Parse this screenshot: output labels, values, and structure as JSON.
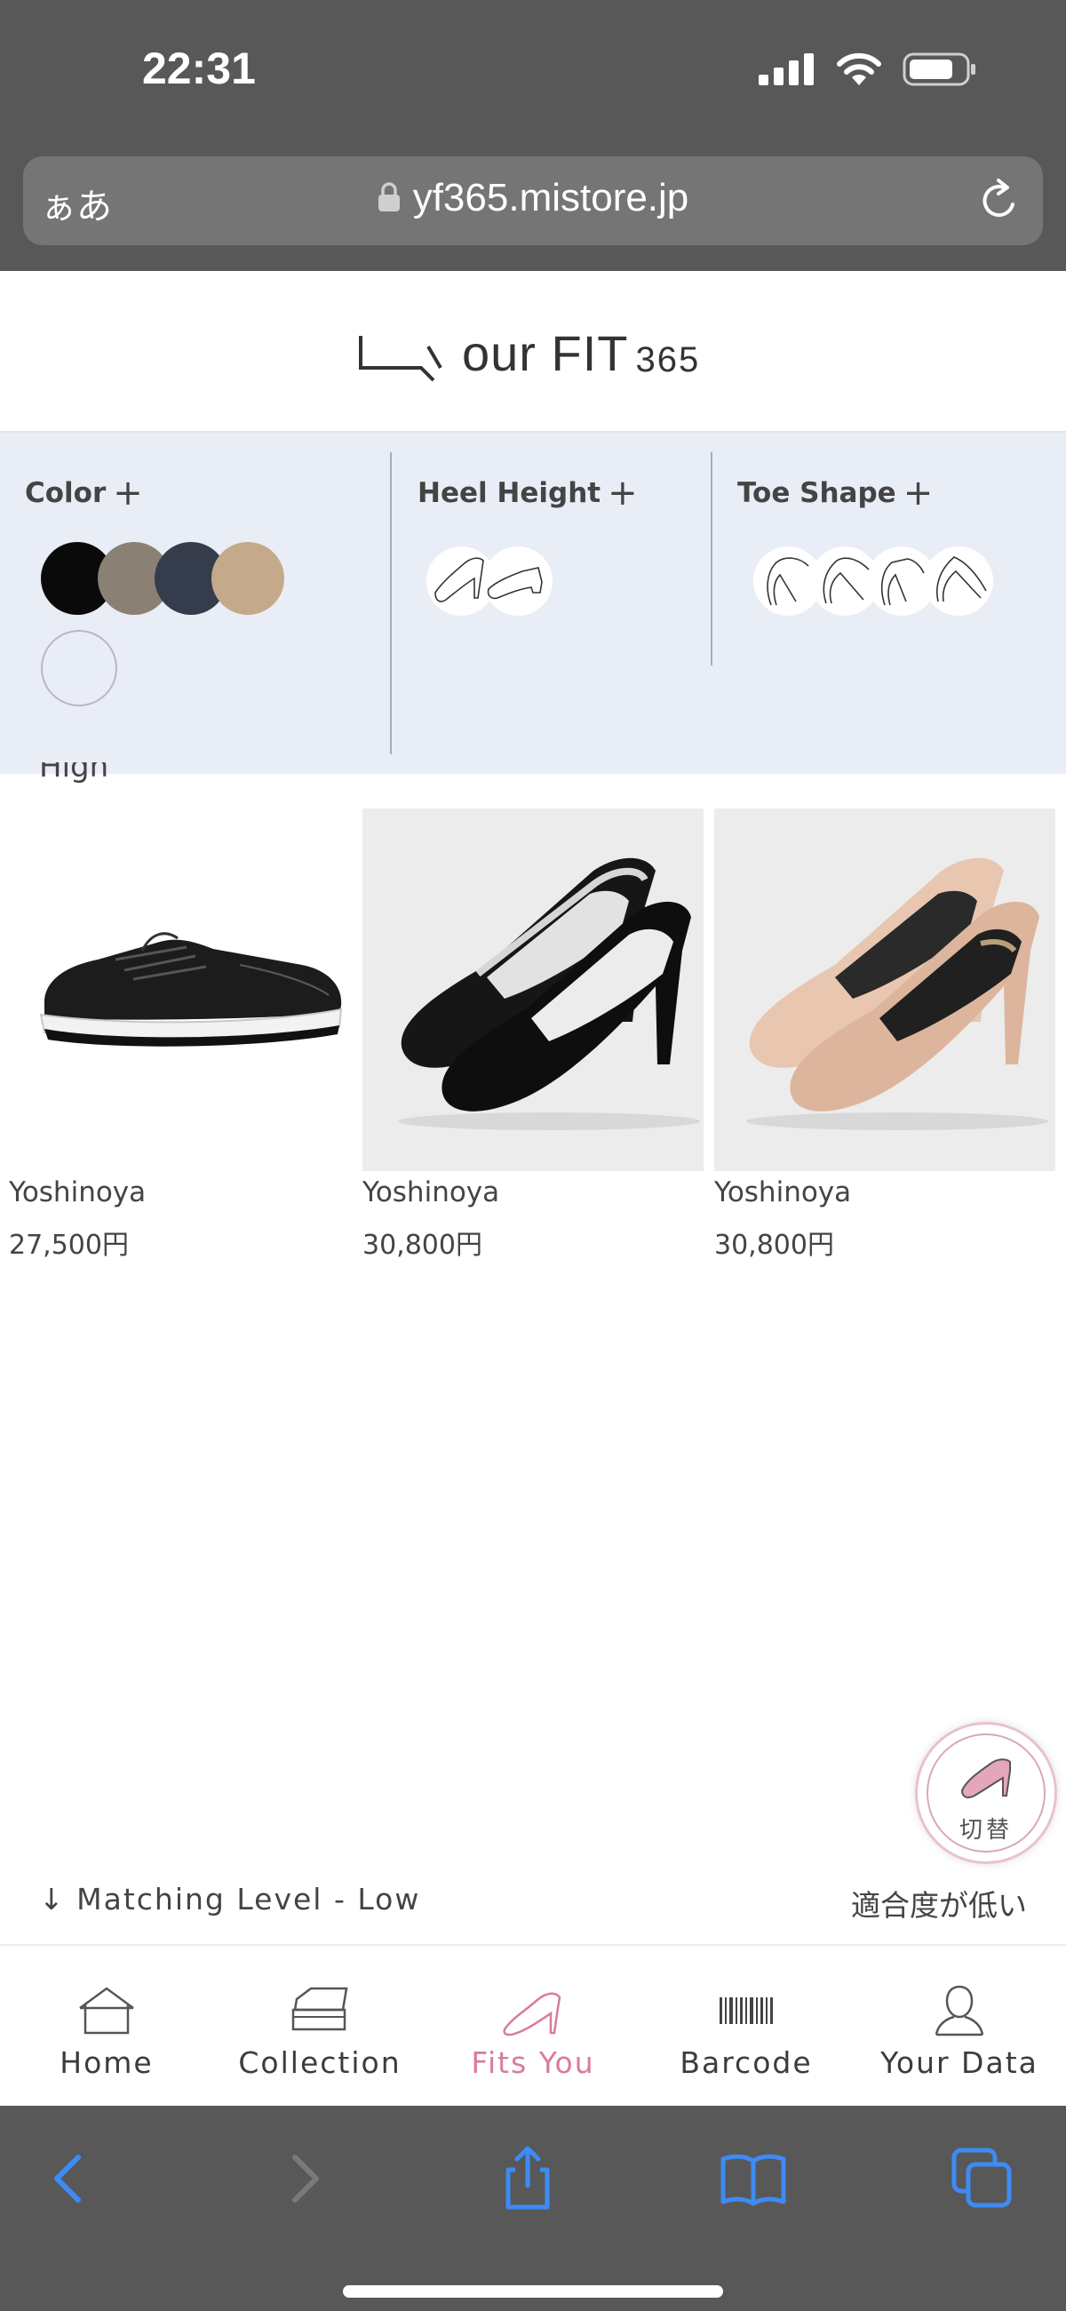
{
  "status": {
    "time": "22:31"
  },
  "browser": {
    "aa_label": "ぁあ",
    "url": "yf365.mistore.jp"
  },
  "brand": {
    "logo_text": "\\_/our FIT",
    "logo_num": "365"
  },
  "filters": {
    "color": {
      "title": "Color",
      "plus": "+",
      "swatches": [
        "#0a0a0a",
        "#8a8074",
        "#353c4c",
        "#c4aa8a",
        "outline"
      ]
    },
    "heel": {
      "title": "Heel Height",
      "plus": "+"
    },
    "toe": {
      "title": "Toe Shape",
      "plus": "+"
    }
  },
  "partial_label": "High",
  "products": [
    {
      "brand": "Yoshinoya",
      "price": "27,500円",
      "image": "black-sneaker"
    },
    {
      "brand": "Yoshinoya",
      "price": "30,800円",
      "image": "black-pump"
    },
    {
      "brand": "Yoshinoya",
      "price": "30,800円",
      "image": "beige-pump"
    }
  ],
  "fab": {
    "label": "切替"
  },
  "matching": {
    "arrow": "↓",
    "left_label": "Matching Level - Low",
    "right_label": "適合度が低い"
  },
  "nav": [
    {
      "label": "Home",
      "icon": "home-icon"
    },
    {
      "label": "Collection",
      "icon": "collection-icon"
    },
    {
      "label": "Fits You",
      "icon": "heel-icon",
      "active": true
    },
    {
      "label": "Barcode",
      "icon": "barcode-icon"
    },
    {
      "label": "Your Data",
      "icon": "user-icon"
    }
  ],
  "colors": {
    "accent": "#d97b9e",
    "panel": "#e9edf6",
    "chrome": "#585858",
    "ios_blue": "#3d8bf5"
  }
}
